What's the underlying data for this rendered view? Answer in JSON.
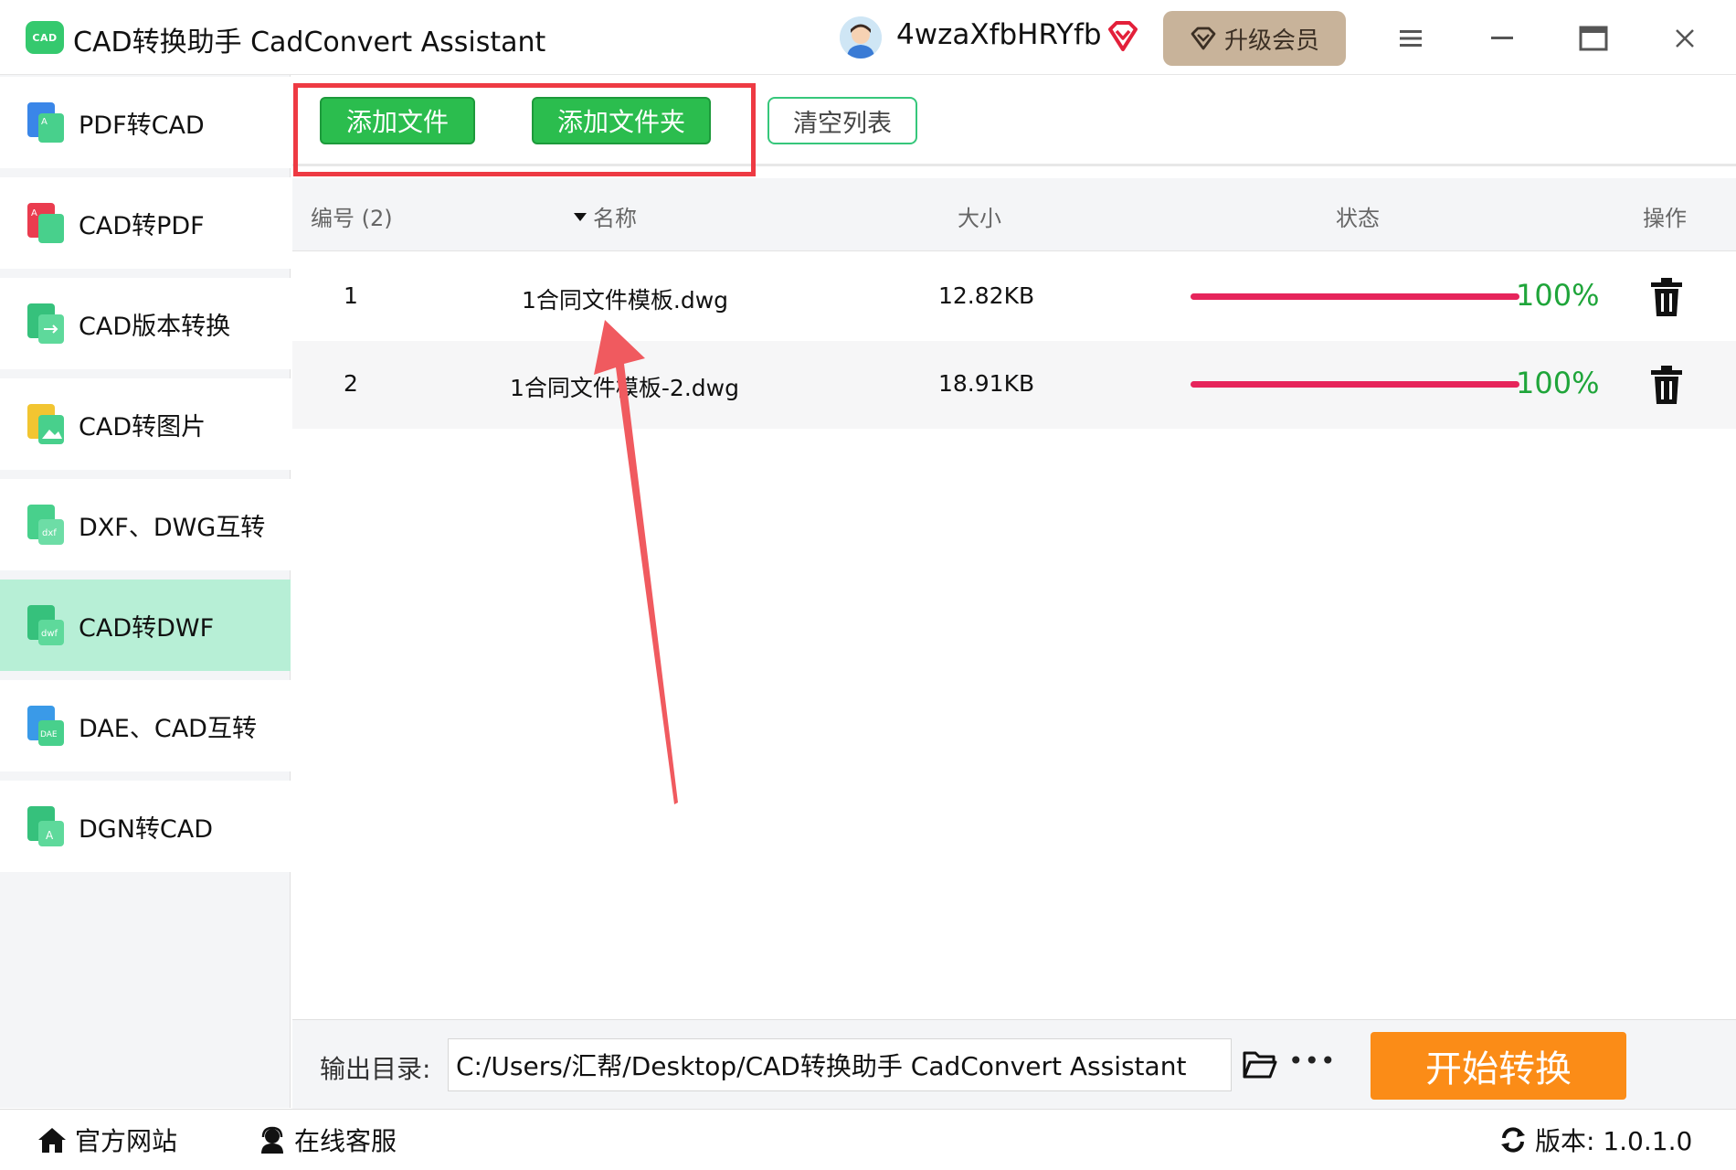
{
  "window": {
    "logo_text": "CAD",
    "title": "CAD转换助手 CadConvert Assistant",
    "username": "4wzaXfbHRYfb",
    "upgrade_label": "升级会员"
  },
  "sidebar": {
    "items": [
      {
        "label": "PDF转CAD",
        "icon": "pdf-to-cad-icon"
      },
      {
        "label": "CAD转PDF",
        "icon": "cad-to-pdf-icon"
      },
      {
        "label": "CAD版本转换",
        "icon": "cad-version-icon"
      },
      {
        "label": "CAD转图片",
        "icon": "cad-to-image-icon"
      },
      {
        "label": "DXF、DWG互转",
        "icon": "dxf-dwg-icon"
      },
      {
        "label": "CAD转DWF",
        "icon": "cad-to-dwf-icon",
        "active": true
      },
      {
        "label": "DAE、CAD互转",
        "icon": "dae-cad-icon"
      },
      {
        "label": "DGN转CAD",
        "icon": "dgn-to-cad-icon"
      }
    ]
  },
  "toolbar": {
    "add_file": "添加文件",
    "add_folder": "添加文件夹",
    "clear_list": "清空列表"
  },
  "table": {
    "headers": {
      "index": "编号 (2)",
      "name": "名称",
      "size": "大小",
      "status": "状态",
      "action": "操作"
    },
    "rows": [
      {
        "index": "1",
        "name": "1合同文件模板.dwg",
        "size": "12.82KB",
        "progress": 1.0,
        "percent": "100%"
      },
      {
        "index": "2",
        "name": "1合同文件模板-2.dwg",
        "size": "18.91KB",
        "progress": 1.0,
        "percent": "100%"
      }
    ]
  },
  "output": {
    "label": "输出目录:",
    "path": "C:/Users/汇帮/Desktop/CAD转换助手 CadConvert Assistant",
    "start_label": "开始转换"
  },
  "statusbar": {
    "website": "官方网站",
    "support": "在线客服",
    "version": "版本: 1.0.1.0"
  },
  "colors": {
    "accent_green": "#2bbd4e",
    "active_sidebar": "#b7efd6",
    "progress": "#e6245b",
    "percent_text": "#1fa53a",
    "start_button": "#fb8c17",
    "highlight": "#ee3a43",
    "upgrade_bg": "#c8b39a"
  }
}
